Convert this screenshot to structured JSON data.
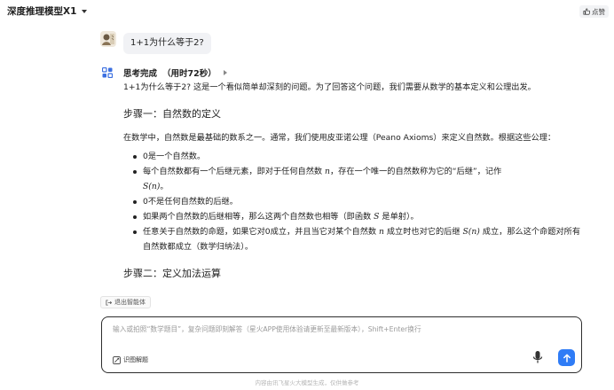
{
  "header": {
    "model_name": "深度推理模型X1",
    "like_label": "点赞"
  },
  "user_message": {
    "text": "1+1为什么等于2?"
  },
  "thinking": {
    "label": "思考完成",
    "time": "（用时72秒）"
  },
  "answer": {
    "intro": "1+1为什么等于2? 这是一个看似简单却深刻的问题。为了回答这个问题，我们需要从数学的基本定义和公理出发。",
    "step1_heading": "步骤一：自然数的定义",
    "step1_body": "在数学中，自然数是最基础的数系之一。通常，我们使用皮亚诺公理（Peano Axioms）来定义自然数。根据这些公理：",
    "bullets": [
      "0是一个自然数。",
      "每个自然数都有一个后继元素，即对于任何自然数",
      "0不是任何自然数的后继。",
      "如果两个自然数的后继相等，那么这两个自然数也相等（即函数",
      "任意关于自然数的命题，如果它对0成立，并且当它对某个自然数"
    ],
    "b2_mid": "，存在一个唯一的自然数称为它的“后继”，记作",
    "b2_end": "。",
    "b4_end": "是单射）。",
    "b5_mid": "成立时也对它的后继",
    "b5_end": "成立，那么这个命题对所有自然数都成立（数学归纳法）。",
    "math_n": "n",
    "math_sn": "S(n)",
    "math_s": "S",
    "step2_heading": "步骤二：定义加法运算"
  },
  "controls": {
    "exit_agent_label": "退出智能体",
    "input_placeholder": "输入或拍照“数学题目”，复杂问题即刻解答（星火APP使用体验请更新至最新版本），Shift+Enter换行",
    "image_solve_label": "识图解题"
  },
  "footer": {
    "disclaimer": "内容由讯飞星火大模型生成，仅供做参考"
  },
  "colors": {
    "accent": "#2f7cf6",
    "bot_icon": "#3b6fe0"
  },
  "icons": [
    "chevron-down-icon",
    "thumbs-up-icon",
    "bot-grid-icon",
    "play-triangle-icon",
    "exit-icon",
    "image-scan-icon",
    "microphone-icon",
    "arrow-up-icon"
  ]
}
